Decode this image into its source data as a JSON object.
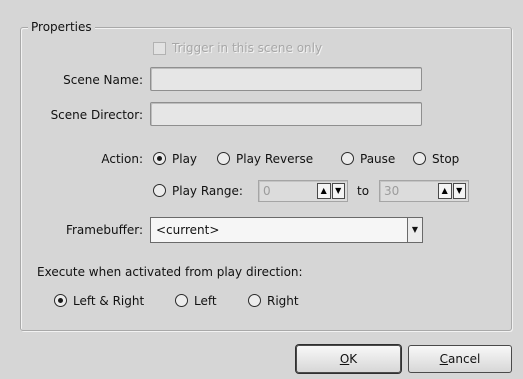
{
  "properties": {
    "legend": "Properties",
    "trigger_label": "Trigger in this scene only",
    "scene_name_label": "Scene Name:",
    "scene_name_value": "",
    "scene_director_label": "Scene Director:",
    "scene_director_value": "",
    "action": {
      "label": "Action:",
      "options": [
        "Play",
        "Play Reverse",
        "Pause",
        "Stop"
      ],
      "selected": "Play",
      "range_label": "Play Range:",
      "range_from": "0",
      "range_to_label": "to",
      "range_to": "30"
    },
    "framebuffer": {
      "label": "Framebuffer:",
      "value": "<current>"
    },
    "execute": {
      "label": "Execute when activated from play direction:",
      "options": [
        "Left & Right",
        "Left",
        "Right"
      ],
      "selected": "Left & Right"
    }
  },
  "buttons": {
    "ok_prefix": "",
    "ok_mnemonic": "O",
    "ok_rest": "K",
    "cancel_mnemonic": "C",
    "cancel_rest": "ancel"
  }
}
